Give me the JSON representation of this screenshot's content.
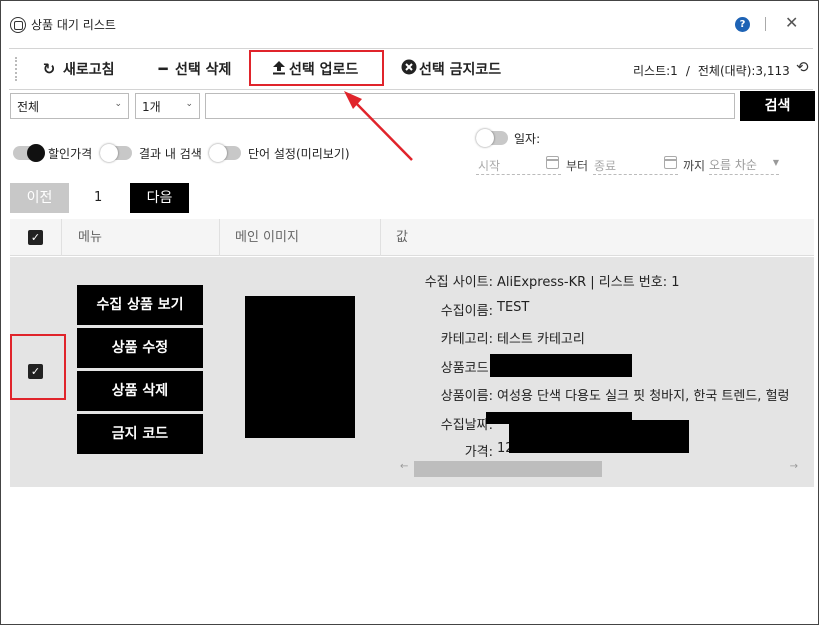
{
  "window": {
    "title": "상품 대기 리스트",
    "help_label": "?",
    "close_label": "✕"
  },
  "toolbar": {
    "refresh_label": "새로고침",
    "delete_label": "선택 삭제",
    "upload_label": "선택 업로드",
    "ban_label": "선택 금지코드",
    "list_info": "리스트:1",
    "total_info": "전체(대략):3,113"
  },
  "search": {
    "category_value": "전체",
    "count_value": "1개",
    "query_value": "",
    "button_label": "검색"
  },
  "options": {
    "discount_price_label": "할인가격",
    "discount_price_on": true,
    "search_in_results_label": "결과 내 검색",
    "search_in_results_on": false,
    "word_settings_label": "단어 설정(미리보기)",
    "word_settings_on": false,
    "date_label": "일자:",
    "date_on": false,
    "start_placeholder": "시작",
    "from_label": "부터",
    "end_placeholder": "종료",
    "until_label": "까지",
    "sort_value": "오름 차순"
  },
  "pager": {
    "prev_label": "이전",
    "page": "1",
    "next_label": "다음"
  },
  "table": {
    "columns": [
      "메뉴",
      "메인 이미지",
      "값"
    ],
    "row": {
      "checked": true,
      "buttons": [
        "수집 상품 보기",
        "상품 수정",
        "상품 삭제",
        "금지 코드"
      ],
      "fields": [
        {
          "key": "수집 사이트:",
          "value": "AliExpress-KR | 리스트 번호: 1"
        },
        {
          "key": "수집이름:",
          "value": "TEST"
        },
        {
          "key": "카테고리:",
          "value": "테스트 카테고리"
        },
        {
          "key": "상품코드:",
          "value": ""
        },
        {
          "key": "상품이름:",
          "value": "여성용 단색 다용도 실크 핏 청바지, 한국 트렌드, 헐렁"
        },
        {
          "key": "수집날짜:",
          "value": ""
        },
        {
          "key": "가격:",
          "value": "12"
        }
      ]
    }
  },
  "colors": {
    "highlight": "#e0242b",
    "help_blue": "#1e63b5"
  },
  "icons": [
    "app-icon",
    "help-icon",
    "close-icon",
    "refresh-icon",
    "minus-icon",
    "upload-icon",
    "ban-icon",
    "reload-icon",
    "calendar-icon",
    "chevron-down-icon",
    "check-icon"
  ]
}
